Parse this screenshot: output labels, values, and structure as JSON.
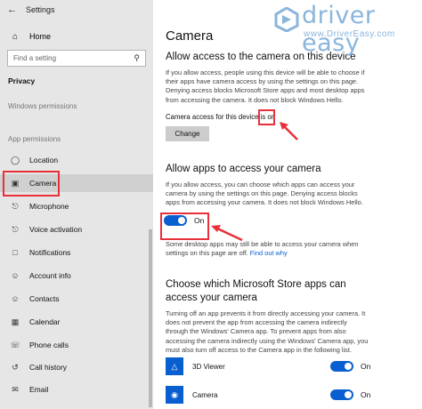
{
  "window": {
    "title": "Settings"
  },
  "sidebar": {
    "home": "Home",
    "search_placeholder": "Find a setting",
    "privacy": "Privacy",
    "windows_permissions": "Windows permissions",
    "app_permissions": "App permissions",
    "items": [
      {
        "label": "Location",
        "icon": "location-icon"
      },
      {
        "label": "Camera",
        "icon": "camera-icon",
        "active": true
      },
      {
        "label": "Microphone",
        "icon": "microphone-icon"
      },
      {
        "label": "Voice activation",
        "icon": "voice-activation-icon"
      },
      {
        "label": "Notifications",
        "icon": "notifications-icon"
      },
      {
        "label": "Account info",
        "icon": "account-info-icon"
      },
      {
        "label": "Contacts",
        "icon": "contacts-icon"
      },
      {
        "label": "Calendar",
        "icon": "calendar-icon"
      },
      {
        "label": "Phone calls",
        "icon": "phone-calls-icon"
      },
      {
        "label": "Call history",
        "icon": "call-history-icon"
      },
      {
        "label": "Email",
        "icon": "email-icon"
      }
    ]
  },
  "main": {
    "title": "Camera",
    "section1": {
      "heading": "Allow access to the camera on this device",
      "description": "If you allow access, people using this device will be able to choose if their apps have camera access by using the settings on this page. Denying access blocks Microsoft Store apps and most desktop apps from accessing the camera. It does not block Windows Hello.",
      "status_prefix": "Camera access for this device is ",
      "status_value": "on",
      "change_label": "Change"
    },
    "section2": {
      "heading": "Allow apps to access your camera",
      "description": "If you allow access, you can choose which apps can access your camera by using the settings on this page. Denying access blocks apps from accessing your camera. It does not block Windows Hello.",
      "toggle_label": "On",
      "note": "Some desktop apps may still be able to access your camera when settings on this page are off. ",
      "note_link": "Find out why"
    },
    "section3": {
      "heading": "Choose which Microsoft Store apps can access your camera",
      "description": "Turning off an app prevents it from directly accessing your camera. It does not prevent the app from accessing the camera indirectly through the Windows' Camera app. To prevent apps from also accessing the camera indirectly using the Windows' Camera app, you must also turn off access to the Camera app in the following list.",
      "apps": [
        {
          "name": "3D Viewer",
          "toggle": "On",
          "icon": "3d-viewer-icon"
        },
        {
          "name": "Camera",
          "toggle": "On",
          "icon": "camera-app-icon"
        }
      ]
    }
  },
  "watermark": {
    "brand": "driver easy",
    "url": "www.DriverEasy.com"
  },
  "colors": {
    "accent": "#0a5fd0",
    "highlight": "#e8303b",
    "sidebar_bg": "#e6e6e6"
  }
}
